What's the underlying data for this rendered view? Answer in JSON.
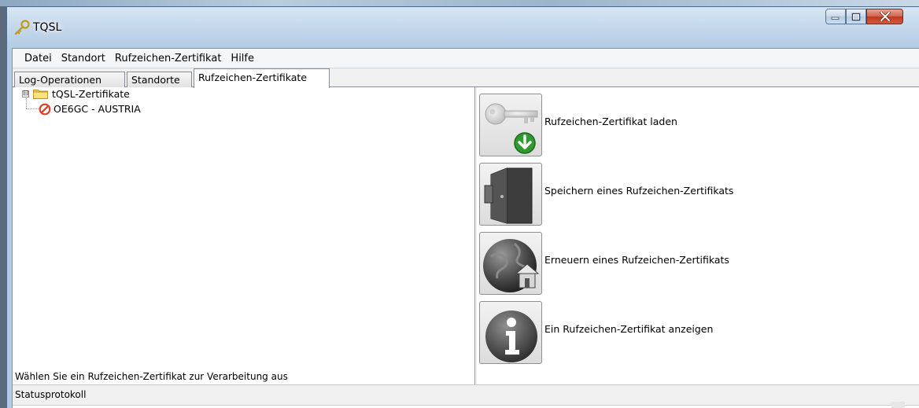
{
  "window": {
    "title": "TQSL",
    "icon": "key-icon",
    "caption_buttons": [
      "minimize-icon",
      "maximize-icon",
      "close-icon"
    ]
  },
  "menu": {
    "items": [
      {
        "label": "Datei"
      },
      {
        "label": "Standort"
      },
      {
        "label": "Rufzeichen-Zertifikat"
      },
      {
        "label": "Hilfe"
      }
    ]
  },
  "tabs": [
    {
      "label": "Log-Operationen",
      "active": false
    },
    {
      "label": "Standorte",
      "active": false
    },
    {
      "label": "Rufzeichen-Zertifikate",
      "active": true
    }
  ],
  "tree": {
    "root": {
      "label": "tQSL-Zertifikate",
      "expander": "⊟",
      "icon": "folder-icon"
    },
    "children": [
      {
        "label": "OE6GC - AUSTRIA",
        "icon": "no-entry-icon"
      }
    ]
  },
  "hint": "Wählen Sie ein Rufzeichen-Zertifikat zur Verarbeitung aus",
  "actions": [
    {
      "label": "Rufzeichen-Zertifikat laden",
      "icon": "key-download-icon"
    },
    {
      "label": "Speichern eines Rufzeichen-Zertifikats",
      "icon": "door-icon"
    },
    {
      "label": "Erneuern eines Rufzeichen-Zertifikats",
      "icon": "globe-house-icon"
    },
    {
      "label": "Ein Rufzeichen-Zertifikat anzeigen",
      "icon": "info-icon"
    }
  ],
  "status": {
    "label": "Statusprotokoll"
  },
  "colors": {
    "title_glass": "#c1d6ea",
    "close_button": "#c1381d",
    "folder": "#f5d14b",
    "no_entry": "#e0402a",
    "download_arrow": "#2f9a2f"
  }
}
